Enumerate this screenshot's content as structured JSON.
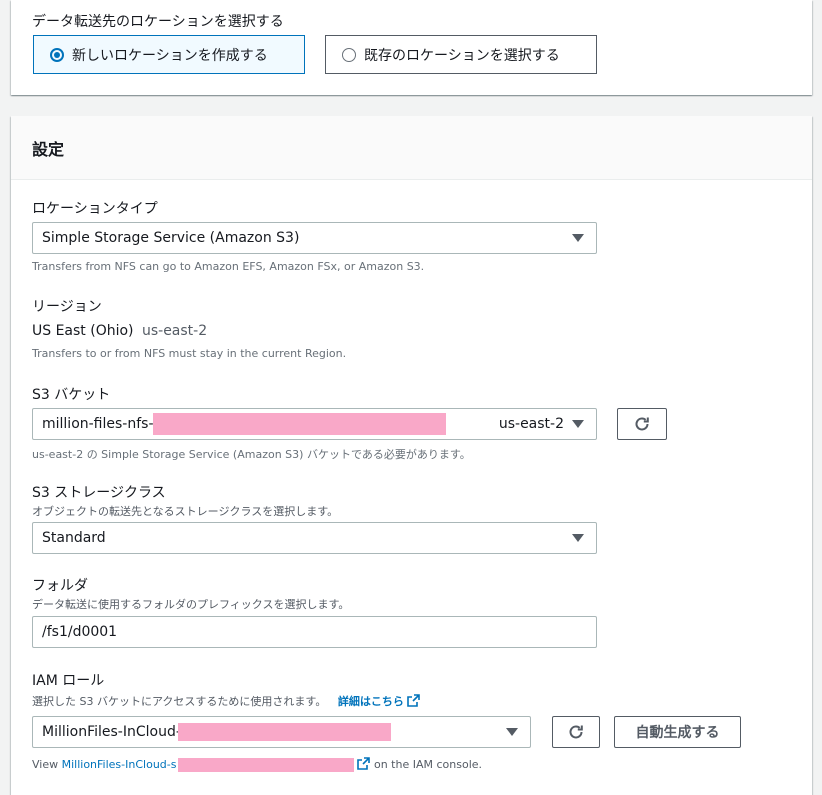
{
  "destination": {
    "heading": "データ転送先のロケーションを選択する",
    "options": [
      {
        "label": "新しいロケーションを作成する",
        "selected": true
      },
      {
        "label": "既存のロケーションを選択する",
        "selected": false
      }
    ]
  },
  "settings": {
    "title": "設定",
    "location_type": {
      "label": "ロケーションタイプ",
      "value": "Simple Storage Service (Amazon S3)",
      "description": "Transfers from NFS can go to Amazon EFS, Amazon FSx, or Amazon S3."
    },
    "region": {
      "label": "リージョン",
      "name": "US East (Ohio)",
      "code": "us-east-2",
      "description": "Transfers to or from NFS must stay in the current Region."
    },
    "s3_bucket": {
      "label": "S3 バケット",
      "value": "million-files-nfs-f",
      "region": "us-east-2",
      "description": "us-east-2 の Simple Storage Service (Amazon S3) バケットである必要があります。"
    },
    "storage_class": {
      "label": "S3 ストレージクラス",
      "description": "オブジェクトの転送先となるストレージクラスを選択します。",
      "value": "Standard"
    },
    "folder": {
      "label": "フォルダ",
      "description": "データ転送に使用するフォルダのプレフィックスを選択します。",
      "value": "/fs1/d0001"
    },
    "iam_role": {
      "label": "IAM ロール",
      "description": "選択した S3 バケットにアクセスするために使用されます。",
      "learn_more": "詳細はこちら",
      "value": "MillionFiles-InCloud-s",
      "auto_generate": "自動生成する",
      "view_prefix": "View",
      "view_link": "MillionFiles-InCloud-s",
      "view_suffix": "on the IAM console."
    }
  },
  "colors": {
    "accent": "#0073bb",
    "redaction": "#f9a8c8"
  }
}
